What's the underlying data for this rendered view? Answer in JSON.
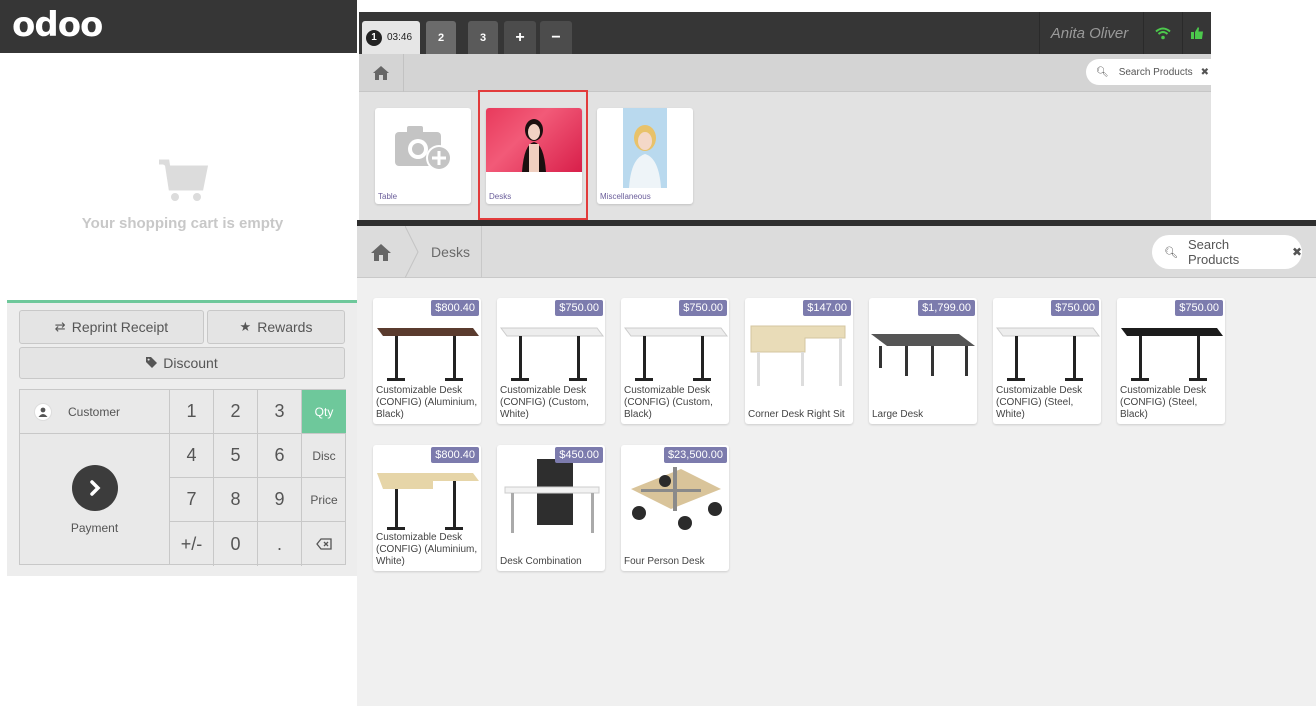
{
  "app": {
    "logo_text": "odoo"
  },
  "topbar": {
    "tabs": [
      {
        "number": "1",
        "time": "03:46"
      },
      {
        "label": "2"
      },
      {
        "label": "3"
      }
    ],
    "add_icon": "+",
    "remove_icon": "−",
    "user_name": "Anita Oliver"
  },
  "top_search": {
    "placeholder": "Search Products"
  },
  "categories": [
    {
      "label": "Table"
    },
    {
      "label": "Desks"
    },
    {
      "label": "Miscellaneous"
    }
  ],
  "cart": {
    "empty_text": "Your shopping cart is empty"
  },
  "controls": {
    "reprint": "Reprint Receipt",
    "rewards": "Rewards",
    "discount": "Discount",
    "customer": "Customer",
    "payment": "Payment",
    "keys": [
      "1",
      "2",
      "3",
      "4",
      "5",
      "6",
      "7",
      "8",
      "9",
      "+/-",
      "0",
      "."
    ],
    "modes": [
      "Qty",
      "Disc",
      "Price"
    ],
    "active_mode": "Qty"
  },
  "main": {
    "breadcrumb": "Desks",
    "search_placeholder": "Search Products",
    "products": [
      {
        "price": "$800.40",
        "name": "Customizable Desk (CONFIG) (Aluminium, Black)"
      },
      {
        "price": "$750.00",
        "name": "Customizable Desk (CONFIG) (Custom, White)"
      },
      {
        "price": "$750.00",
        "name": "Customizable Desk (CONFIG) (Custom, Black)"
      },
      {
        "price": "$147.00",
        "name": "Corner Desk Right Sit"
      },
      {
        "price": "$1,799.00",
        "name": "Large Desk"
      },
      {
        "price": "$750.00",
        "name": "Customizable Desk (CONFIG) (Steel, White)"
      },
      {
        "price": "$750.00",
        "name": "Customizable Desk (CONFIG) (Steel, Black)"
      },
      {
        "price": "$800.40",
        "name": "Customizable Desk (CONFIG) (Aluminium, White)"
      },
      {
        "price": "$450.00",
        "name": "Desk Combination"
      },
      {
        "price": "$23,500.00",
        "name": "Four Person Desk"
      }
    ]
  },
  "colors": {
    "accent": "#6ec89b",
    "price_tag": "#7c7bad",
    "header": "#363636",
    "highlight": "#e23b3b"
  }
}
